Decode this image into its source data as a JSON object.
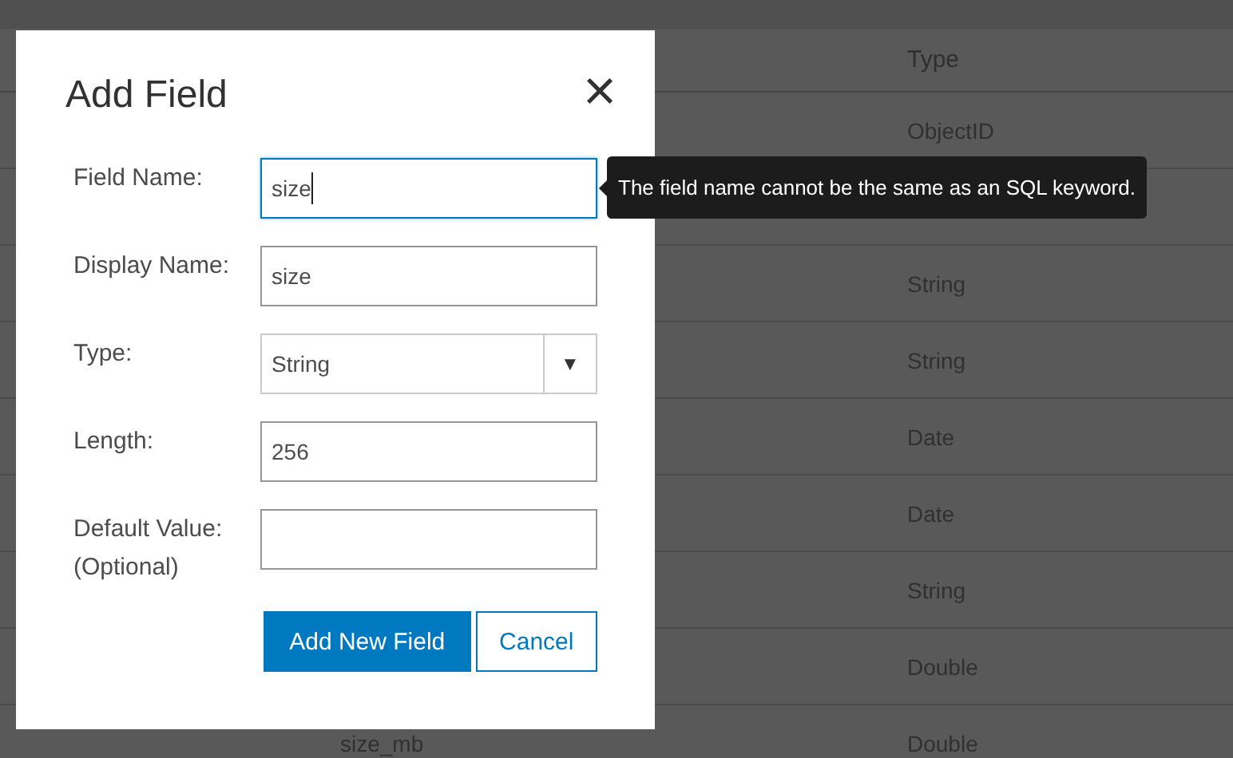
{
  "table": {
    "type_header": "Type",
    "rows": [
      {
        "type": "ObjectID"
      },
      {},
      {
        "type": "String"
      },
      {
        "type": "String"
      },
      {
        "type": "Date"
      },
      {
        "type": "Date"
      },
      {
        "type": "String"
      },
      {
        "type": "Double"
      },
      {
        "column_1": "size_mb",
        "type": "Double"
      }
    ]
  },
  "dialog": {
    "title": "Add Field",
    "close": "×",
    "fields": [
      {
        "kind": "text",
        "label": "Field Name:",
        "value": "size",
        "focused": true
      },
      {
        "kind": "text",
        "label": "Display Name:",
        "value": "size",
        "focused": false
      },
      {
        "kind": "select",
        "label": "Type:",
        "value": "String",
        "arrow": "▼"
      },
      {
        "kind": "text",
        "label": "Length:",
        "value": "256",
        "focused": false
      },
      {
        "kind": "text",
        "label": "Default Value:",
        "label_2": "(Optional)",
        "focused": false
      }
    ],
    "buttons": [
      {
        "kind": "primary",
        "label": "Add New Field"
      },
      {
        "kind": "secondary",
        "label": "Cancel"
      }
    ]
  },
  "tooltip": {
    "text": "The field name cannot be the same as an SQL keyword."
  }
}
